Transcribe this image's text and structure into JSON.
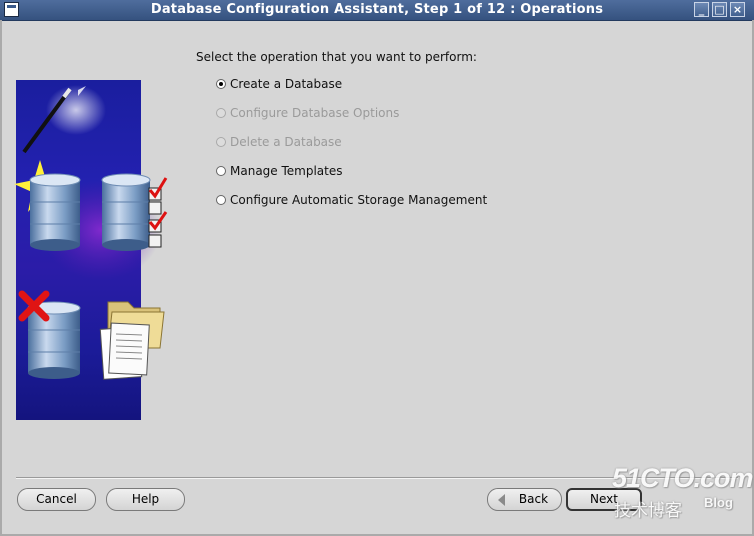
{
  "window": {
    "title": "Database Configuration Assistant, Step 1 of 12 : Operations",
    "controls": {
      "minimize": "_",
      "maximize": "□",
      "close": "×"
    }
  },
  "main": {
    "prompt": "Select the operation that you want to perform:",
    "options": [
      {
        "label": "Create a Database",
        "selected": true,
        "enabled": true
      },
      {
        "label": "Configure Database Options",
        "selected": false,
        "enabled": false
      },
      {
        "label": "Delete a Database",
        "selected": false,
        "enabled": false
      },
      {
        "label": "Manage Templates",
        "selected": false,
        "enabled": true
      },
      {
        "label": "Configure Automatic Storage Management",
        "selected": false,
        "enabled": true
      }
    ]
  },
  "buttons": {
    "cancel": "Cancel",
    "help": "Help",
    "back": "Back",
    "next": "Next"
  },
  "watermark": {
    "site": "51CTO.com",
    "subtitle": "技术博客",
    "blog": "Blog"
  },
  "colors": {
    "titlebar": "#3f5e8f",
    "background": "#d6d6d6",
    "banner": "#2321b0",
    "disabled_text": "#9a9a9a"
  }
}
